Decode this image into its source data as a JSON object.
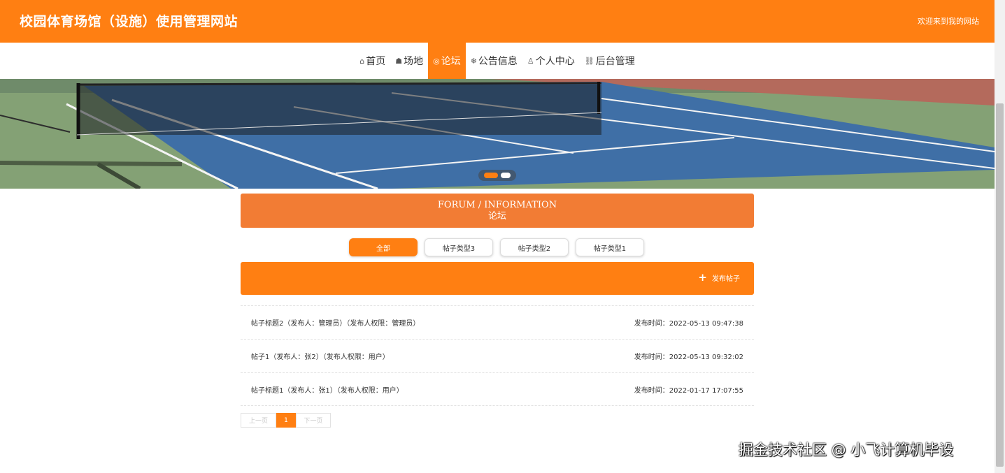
{
  "header": {
    "site_title": "校园体育场馆（设施）使用管理网站",
    "welcome": "欢迎来到我的网站"
  },
  "nav": {
    "items": [
      {
        "label": "首页",
        "icon": "home-icon",
        "glyph": "⌂"
      },
      {
        "label": "场地",
        "icon": "layers-icon",
        "glyph": "☗"
      },
      {
        "label": "论坛",
        "icon": "chat-icon",
        "glyph": "◎"
      },
      {
        "label": "公告信息",
        "icon": "snowflake-icon",
        "glyph": "❄"
      },
      {
        "label": "个人中心",
        "icon": "user-icon",
        "glyph": "♙"
      },
      {
        "label": "后台管理",
        "icon": "link-icon",
        "glyph": "⛓"
      }
    ],
    "active_index": 2
  },
  "section": {
    "title_en": "FORUM / INFORMATION",
    "title_cn": "论坛"
  },
  "tabs": [
    "全部",
    "帖子类型3",
    "帖子类型2",
    "帖子类型1"
  ],
  "action_bar": {
    "publish_icon": "+",
    "publish_label": "发布帖子"
  },
  "posts": [
    {
      "title": "帖子标题2（发布人：管理员）（发布人权限：管理员）",
      "time": "发布时间：2022-05-13 09:47:38"
    },
    {
      "title": "帖子1（发布人：张2）（发布人权限：用户）",
      "time": "发布时间：2022-05-13 09:32:02"
    },
    {
      "title": "帖子标题1（发布人：张1）（发布人权限：用户）",
      "time": "发布时间：2022-01-17 17:07:55"
    }
  ],
  "pager": {
    "prev": "上一页",
    "current": "1",
    "next": "下一页"
  },
  "watermark": "掘金技术社区 @ 小飞计算机毕设",
  "colors": {
    "accent": "#ff7f12",
    "section_title": "#f27c34"
  }
}
